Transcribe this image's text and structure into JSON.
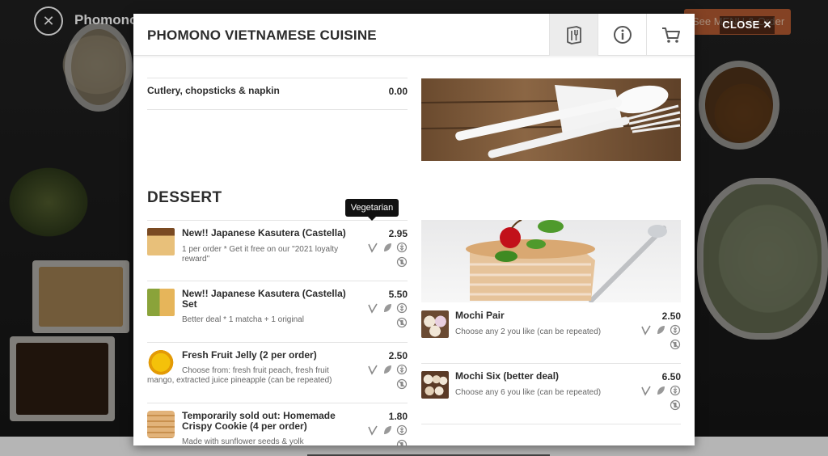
{
  "background": {
    "brand": "Phomono",
    "cta_label": "See MENU & Order",
    "close_label": "CLOSE"
  },
  "modal": {
    "title": "PHOMONO VIETNAMESE CUISINE",
    "header_buttons": [
      {
        "name": "menu-icon",
        "active": true
      },
      {
        "name": "info-icon",
        "active": false
      },
      {
        "name": "cart-icon",
        "active": false
      }
    ]
  },
  "items_top": [
    {
      "name": "Cutlery, chopsticks & napkin",
      "price": "0.00"
    }
  ],
  "section": {
    "title": "DESSERT",
    "tooltip": "Vegetarian"
  },
  "dessert_left": [
    {
      "name": "New!! Japanese Kasutera (Castella)",
      "price": "2.95",
      "desc": "1 per order * Get it free on our \"2021 loyalty reward\""
    },
    {
      "name": "New!! Japanese Kasutera (Castella) Set",
      "price": "5.50",
      "desc": "Better deal * 1 matcha + 1 original"
    },
    {
      "name": "Fresh Fruit Jelly (2 per order)",
      "price": "2.50",
      "desc": "Choose from: fresh fruit peach, fresh fruit mango, extracted juice pineapple (can be repeated)"
    },
    {
      "name": "Temporarily sold out: Homemade Crispy Cookie (4 per order)",
      "price": "1.80",
      "desc": "Made with sunflower seeds & yolk"
    }
  ],
  "dessert_right": [
    {
      "name": "Mochi Pair",
      "price": "2.50",
      "desc": "Choose any 2 you like (can be repeated)"
    },
    {
      "name": "Mochi Six (better deal)",
      "price": "6.50",
      "desc": "Choose any 6 you like (can be repeated)"
    }
  ],
  "colors": {
    "accent": "#b3552a",
    "text": "#2c2c2c",
    "muted": "#666666"
  }
}
